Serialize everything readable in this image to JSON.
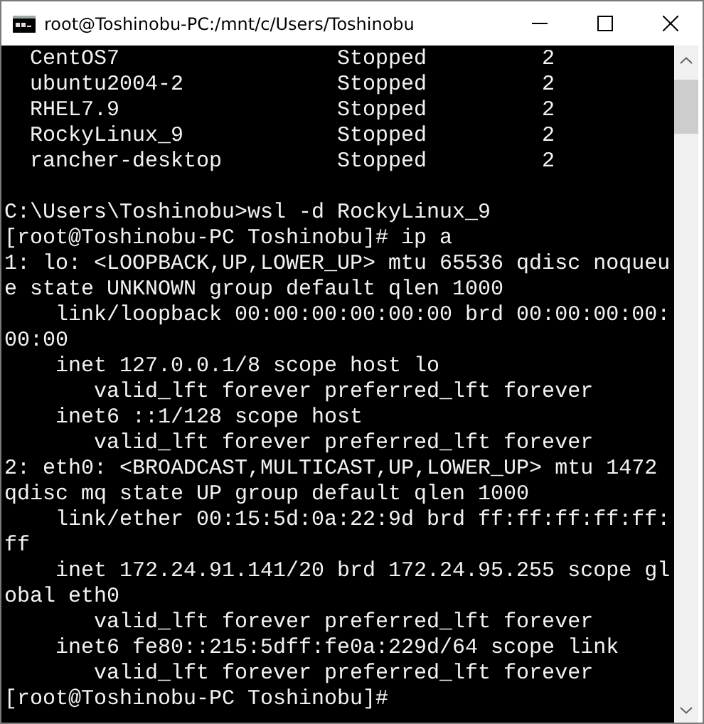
{
  "window": {
    "title": "root@Toshinobu-PC:/mnt/c/Users/Toshinobu"
  },
  "distros": [
    {
      "name": "CentOS7",
      "state": "Stopped",
      "version": "2"
    },
    {
      "name": "ubuntu2004-2",
      "state": "Stopped",
      "version": "2"
    },
    {
      "name": "RHEL7.9",
      "state": "Stopped",
      "version": "2"
    },
    {
      "name": "RockyLinux_9",
      "state": "Stopped",
      "version": "2"
    },
    {
      "name": "rancher-desktop",
      "state": "Stopped",
      "version": "2"
    }
  ],
  "output_lines": [
    "C:\\Users\\Toshinobu>wsl -d RockyLinux_9",
    "[root@Toshinobu-PC Toshinobu]# ip a",
    "1: lo: <LOOPBACK,UP,LOWER_UP> mtu 65536 qdisc noqueu",
    "e state UNKNOWN group default qlen 1000",
    "    link/loopback 00:00:00:00:00:00 brd 00:00:00:00:",
    "00:00",
    "    inet 127.0.0.1/8 scope host lo",
    "       valid_lft forever preferred_lft forever",
    "    inet6 ::1/128 scope host",
    "       valid_lft forever preferred_lft forever",
    "2: eth0: <BROADCAST,MULTICAST,UP,LOWER_UP> mtu 1472",
    "qdisc mq state UP group default qlen 1000",
    "    link/ether 00:15:5d:0a:22:9d brd ff:ff:ff:ff:ff:",
    "ff",
    "    inet 172.24.91.141/20 brd 172.24.95.255 scope gl",
    "obal eth0",
    "       valid_lft forever preferred_lft forever",
    "    inet6 fe80::215:5dff:fe0a:229d/64 scope link",
    "       valid_lft forever preferred_lft forever",
    "[root@Toshinobu-PC Toshinobu]#"
  ]
}
